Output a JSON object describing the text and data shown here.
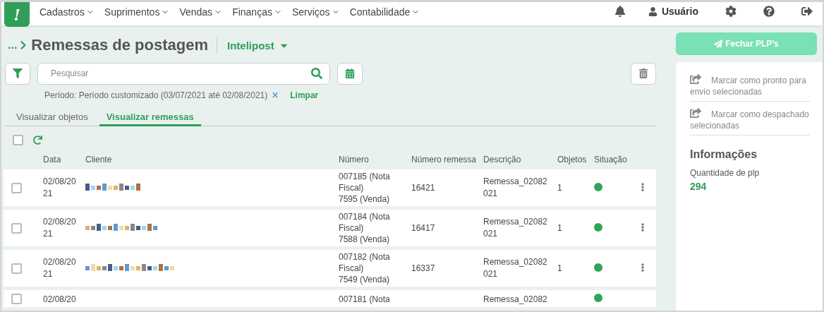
{
  "logo": {
    "text": "!"
  },
  "nav": {
    "menus": [
      {
        "label": "Cadastros"
      },
      {
        "label": "Suprimentos"
      },
      {
        "label": "Vendas"
      },
      {
        "label": "Finanças"
      },
      {
        "label": "Serviços"
      },
      {
        "label": "Contabilidade"
      }
    ],
    "user": "Usuário"
  },
  "header": {
    "breadcrumb": "...",
    "title": "Remessas de postagem",
    "integration": "Intelipost"
  },
  "search": {
    "placeholder": "Pesquisar"
  },
  "filter": {
    "text": "Período: Período customizado (03/07/2021 até 02/08/2021)",
    "clear_icon": "✕",
    "clear": "Limpar"
  },
  "tabs": [
    {
      "label": "Visualizar objetos",
      "selected": false
    },
    {
      "label": "Visualizar remessas",
      "selected": true
    }
  ],
  "select_all": {
    "checked": false
  },
  "table": {
    "columns": [
      "Data",
      "Cliente",
      "Número",
      "Número remessa",
      "Descrição",
      "Objetos",
      "Situação"
    ],
    "rows": [
      {
        "checked": false,
        "date": "02/08/2021",
        "numbers": [
          "007185 (Nota Fiscal)",
          "7595 (Venda)"
        ],
        "shipment": "16421",
        "description": "Remessa_02082021",
        "objects": "1",
        "color": "#2ea55a"
      },
      {
        "checked": false,
        "date": "02/08/2021",
        "numbers": [
          "007184 (Nota Fiscal)",
          "7588 (Venda)"
        ],
        "shipment": "16417",
        "description": "Remessa_02082021",
        "objects": "1",
        "color": "#2ea55a"
      },
      {
        "checked": false,
        "date": "02/08/2021",
        "numbers": [
          "007182 (Nota Fiscal)",
          "7549 (Venda)"
        ],
        "shipment": "16337",
        "description": "Remessa_02082021",
        "objects": "1",
        "color": "#2ea55a"
      },
      {
        "checked": false,
        "date": "02/08/20",
        "numbers": [
          "007181 (Nota"
        ],
        "description": "Remessa_02082",
        "color": "#2ea55a"
      }
    ]
  },
  "side": {
    "button": "Fechar PLP’s",
    "actions": [
      "Marcar como pronto para envio selecionadas",
      "Marcar como despachado selecionadas"
    ],
    "info_title": "Informações",
    "info_label": "Quantidade de plp",
    "info_value": "294"
  }
}
